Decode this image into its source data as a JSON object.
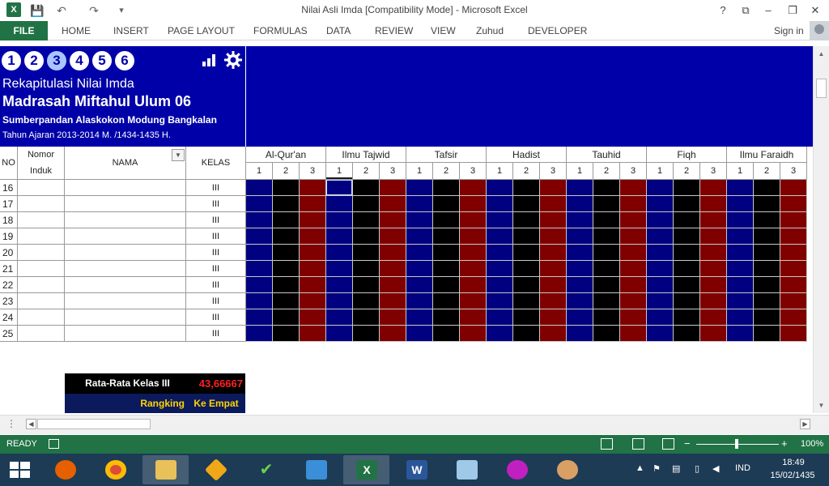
{
  "window": {
    "title": "Nilai Asli Imda  [Compatibility Mode] - Microsoft Excel",
    "help": "?",
    "restore_ribbon": "⧉",
    "minimize": "–",
    "maximize": "❐",
    "close": "✕"
  },
  "qat": {
    "save": "💾",
    "undo": "↶",
    "redo": "↷",
    "customize": "▾"
  },
  "ribbon": {
    "file": "FILE",
    "tabs": [
      "HOME",
      "INSERT",
      "PAGE LAYOUT",
      "FORMULAS",
      "DATA",
      "REVIEW",
      "VIEW",
      "Zuhud",
      "DEVELOPER"
    ],
    "sign_in": "Sign in"
  },
  "banner": {
    "numbers": [
      "1",
      "2",
      "3",
      "4",
      "5",
      "6"
    ],
    "active_number": "3",
    "subtitle": "Rekapitulasi Nilai Imda",
    "school": "Madrasah Miftahul Ulum 06",
    "location": "Sumberpandan Alaskokon Modung Bangkalan",
    "year": "Tahun Ajaran  2013-2014 M. /1434-1435 H."
  },
  "headers": {
    "no": "NO",
    "nomor_induk": "Nomor Induk",
    "nama": "NAMA",
    "kelas": "KELAS"
  },
  "subjects": [
    "Al-Qur'an",
    "Ilmu Tajwid",
    "Tafsir",
    "Hadist",
    "Tauhid",
    "Fiqh",
    "Ilmu Faraidh"
  ],
  "subject_cols": [
    "1",
    "2",
    "3"
  ],
  "rows": [
    {
      "no": "16",
      "kelas": "III"
    },
    {
      "no": "17",
      "kelas": "III"
    },
    {
      "no": "18",
      "kelas": "III"
    },
    {
      "no": "19",
      "kelas": "III"
    },
    {
      "no": "20",
      "kelas": "III"
    },
    {
      "no": "21",
      "kelas": "III"
    },
    {
      "no": "22",
      "kelas": "III"
    },
    {
      "no": "23",
      "kelas": "III"
    },
    {
      "no": "24",
      "kelas": "III"
    },
    {
      "no": "25",
      "kelas": "III"
    }
  ],
  "colors": {
    "col1": "#000080",
    "col2": "#000000",
    "col3": "#800000",
    "banner": "#0000a8"
  },
  "summary": {
    "label": "Rata-Rata Kelas III",
    "value": "43,66667",
    "rank_label": "Rangking",
    "rank_value": "Ke Empat"
  },
  "status": {
    "ready": "READY",
    "zoom": "100%"
  },
  "taskbar": {
    "language": "IND",
    "time": "18:49",
    "date": "15/02/1435"
  }
}
